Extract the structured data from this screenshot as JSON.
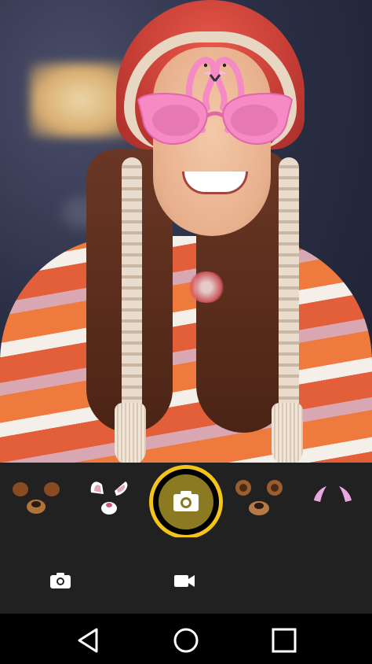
{
  "camera_preview": {
    "active_filter": "flamingo-heart-glasses"
  },
  "filters": {
    "items": [
      {
        "id": "puppy-dog-ears",
        "icon": "puppy-filter-icon"
      },
      {
        "id": "bunny-ears",
        "icon": "bunny-filter-icon"
      },
      {
        "id": "teddy-bear-ears",
        "icon": "bear-filter-icon"
      },
      {
        "id": "pink-horns",
        "icon": "horns-filter-icon"
      }
    ]
  },
  "capture": {
    "icon": "camera-icon",
    "ring_color": "#f4c41b",
    "inner_color": "#8c7a22"
  },
  "modes": {
    "photo_icon": "camera-icon",
    "video_icon": "video-camera-icon"
  },
  "navigation": {
    "back_icon": "back-triangle-icon",
    "home_icon": "home-circle-icon",
    "recents_icon": "recents-square-icon"
  },
  "colors": {
    "toolbar_bg": "#212121",
    "nav_bg": "#000000",
    "accent": "#f4c41b"
  }
}
